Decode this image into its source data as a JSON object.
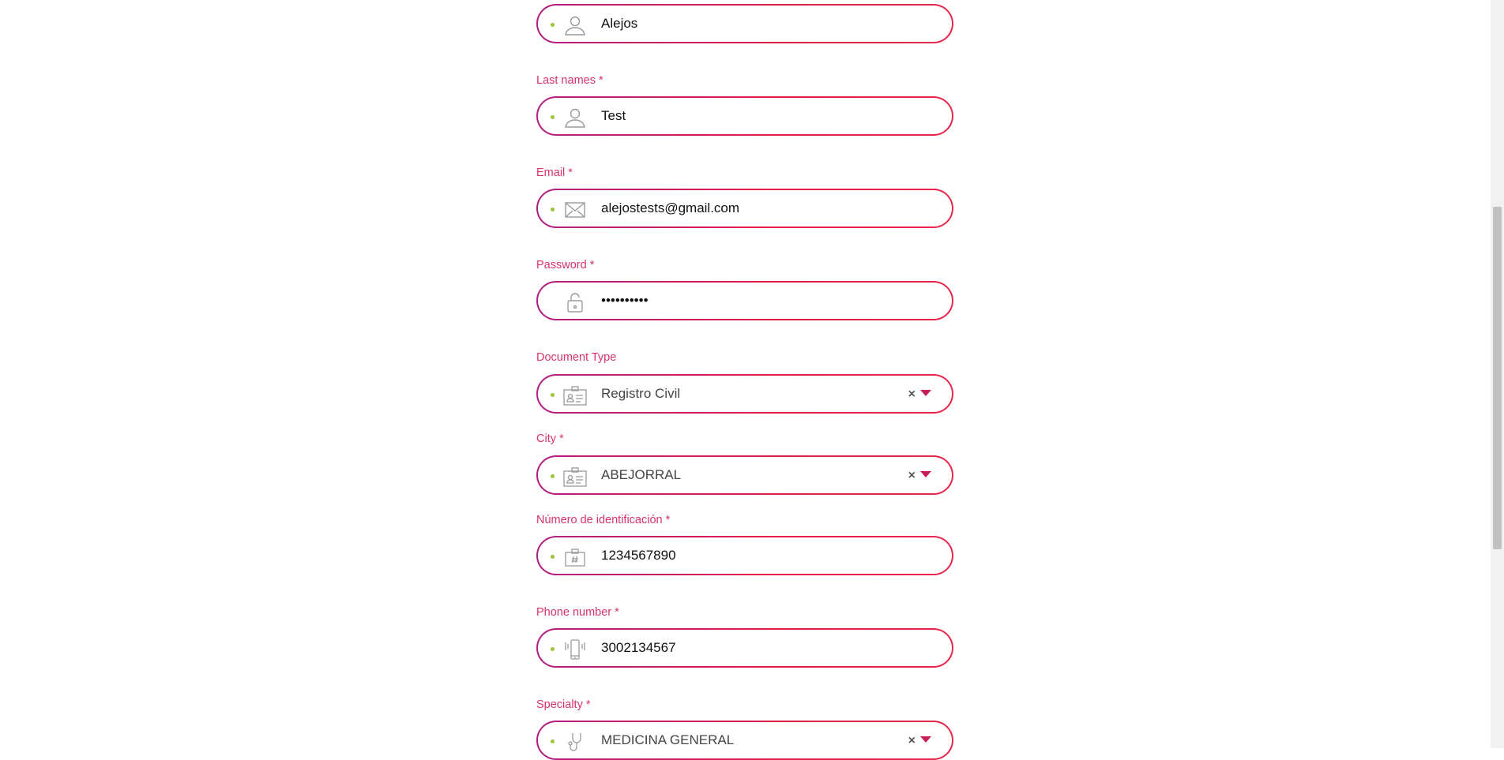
{
  "form": {
    "first_name": {
      "value": "Alejos",
      "icon": "user-icon"
    },
    "last_name": {
      "label": "Last names *",
      "value": "Test",
      "icon": "user-icon"
    },
    "email": {
      "label": "Email *",
      "value": "alejostests@gmail.com",
      "icon": "envelope-icon"
    },
    "password": {
      "label": "Password *",
      "value": "••••••••••",
      "icon": "lock-icon"
    },
    "document_type": {
      "label": "Document Type",
      "value": "Registro Civil",
      "icon": "id-card-icon",
      "clear": "×"
    },
    "city": {
      "label": "City *",
      "value": "ABEJORRAL",
      "icon": "id-card-icon",
      "clear": "×"
    },
    "id_number": {
      "label": "Número de identificación *",
      "value": "1234567890",
      "icon": "badge-number-icon"
    },
    "phone": {
      "label": "Phone number *",
      "value": "3002134567",
      "icon": "mobile-phone-icon"
    },
    "specialty": {
      "label": "Specialty *",
      "value": "MEDICINA GENERAL",
      "icon": "stethoscope-icon",
      "clear": "×"
    }
  },
  "colors": {
    "label": "#d6336c",
    "border_start": "#b01e82",
    "border_end": "#e8284a",
    "dot": "#9dc43a",
    "caret": "#c81e5b"
  }
}
